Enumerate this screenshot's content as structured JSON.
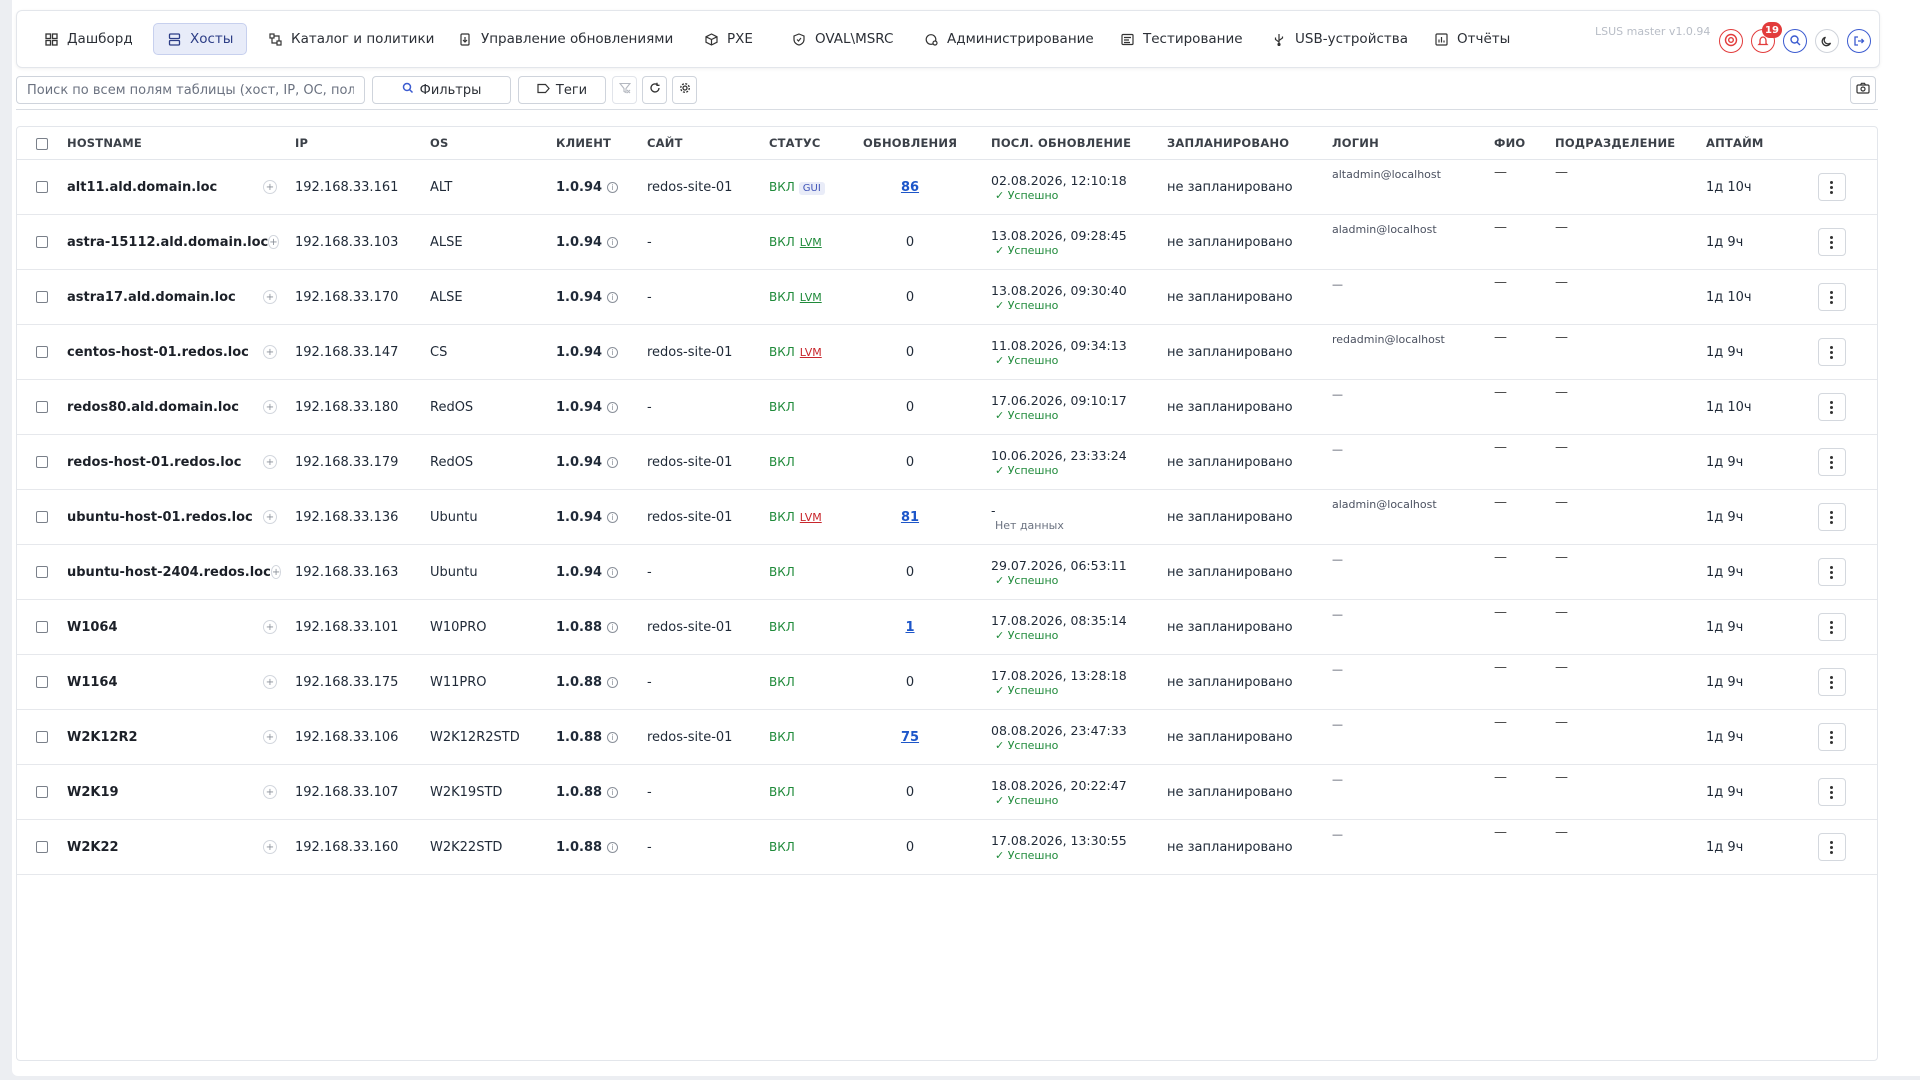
{
  "nav": {
    "tabs": [
      {
        "label": "Дашборд",
        "icon": "dashboard-icon"
      },
      {
        "label": "Хосты",
        "icon": "hosts-icon",
        "active": true
      },
      {
        "label": "Каталог и политики",
        "icon": "catalog-icon"
      },
      {
        "label": "Управление обновлениями",
        "icon": "updates-icon"
      },
      {
        "label": "PXE",
        "icon": "pxe-icon"
      },
      {
        "label": "OVAL\\MSRC",
        "icon": "shield-icon"
      },
      {
        "label": "Администрирование",
        "icon": "admin-icon"
      },
      {
        "label": "Тестирование",
        "icon": "testing-icon"
      },
      {
        "label": "USB-устройства",
        "icon": "usb-icon"
      },
      {
        "label": "Отчёты",
        "icon": "reports-icon"
      }
    ],
    "version": "LSUS master v1.0.94",
    "notification_count": "19"
  },
  "toolbar": {
    "search_placeholder": "Поиск по всем полям таблицы (хост, IP, ОС, политика,",
    "filters_label": "Фильтры",
    "tags_label": "Теги"
  },
  "colors": {
    "accent": "#2c3d86",
    "success": "#1f8a3a",
    "danger": "#c8262c",
    "link": "#1d56c9"
  },
  "table": {
    "columns": [
      "HOSTNAME",
      "IP",
      "OS",
      "КЛИЕНТ",
      "САЙТ",
      "СТАТУС",
      "ОБНОВЛЕНИЯ",
      "ПОСЛ. ОБНОВЛЕНИЕ",
      "ЗАПЛАНИРОВАНО",
      "ЛОГИН",
      "ФИО",
      "ПОДРАЗДЕЛЕНИЕ",
      "АПТАЙМ"
    ],
    "rows": [
      {
        "hostname": "alt11.ald.domain.loc",
        "ip": "192.168.33.161",
        "os": "ALT",
        "client": "1.0.94",
        "site": "redos-site-01",
        "status": "ВКЛ",
        "tag": "GUI",
        "tag_type": "gui",
        "updates": "86",
        "updates_link": true,
        "last_update": "02.08.2026, 12:10:18",
        "last_result": "✓ Успешно",
        "scheduled": "не запланировано",
        "login": "altadmin@localhost",
        "fio": "—",
        "dept": "—",
        "uptime": "1д 10ч"
      },
      {
        "hostname": "astra-15112.ald.domain.loc",
        "ip": "192.168.33.103",
        "os": "ALSE",
        "client": "1.0.94",
        "site": "-",
        "status": "ВКЛ",
        "tag": "LVM",
        "tag_type": "lvm-g",
        "updates": "0",
        "updates_link": false,
        "last_update": "13.08.2026, 09:28:45",
        "last_result": "✓ Успешно",
        "scheduled": "не запланировано",
        "login": "aladmin@localhost",
        "fio": "—",
        "dept": "—",
        "uptime": "1д 9ч"
      },
      {
        "hostname": "astra17.ald.domain.loc",
        "ip": "192.168.33.170",
        "os": "ALSE",
        "client": "1.0.94",
        "site": "-",
        "status": "ВКЛ",
        "tag": "LVM",
        "tag_type": "lvm-g",
        "updates": "0",
        "updates_link": false,
        "last_update": "13.08.2026, 09:30:40",
        "last_result": "✓ Успешно",
        "scheduled": "не запланировано",
        "login": "—",
        "fio": "—",
        "dept": "—",
        "uptime": "1д 10ч"
      },
      {
        "hostname": "centos-host-01.redos.loc",
        "ip": "192.168.33.147",
        "os": "CS",
        "client": "1.0.94",
        "site": "redos-site-01",
        "status": "ВКЛ",
        "tag": "LVM",
        "tag_type": "lvm-r",
        "updates": "0",
        "updates_link": false,
        "last_update": "11.08.2026, 09:34:13",
        "last_result": "✓ Успешно",
        "scheduled": "не запланировано",
        "login": "redadmin@localhost",
        "fio": "—",
        "dept": "—",
        "uptime": "1д 9ч"
      },
      {
        "hostname": "redos80.ald.domain.loc",
        "ip": "192.168.33.180",
        "os": "RedOS",
        "client": "1.0.94",
        "site": "-",
        "status": "ВКЛ",
        "tag": "",
        "tag_type": "",
        "updates": "0",
        "updates_link": false,
        "last_update": "17.06.2026, 09:10:17",
        "last_result": "✓ Успешно",
        "scheduled": "не запланировано",
        "login": "—",
        "fio": "—",
        "dept": "—",
        "uptime": "1д 10ч"
      },
      {
        "hostname": "redos-host-01.redos.loc",
        "ip": "192.168.33.179",
        "os": "RedOS",
        "client": "1.0.94",
        "site": "redos-site-01",
        "status": "ВКЛ",
        "tag": "",
        "tag_type": "",
        "updates": "0",
        "updates_link": false,
        "last_update": "10.06.2026, 23:33:24",
        "last_result": "✓ Успешно",
        "scheduled": "не запланировано",
        "login": "—",
        "fio": "—",
        "dept": "—",
        "uptime": "1д 9ч"
      },
      {
        "hostname": "ubuntu-host-01.redos.loc",
        "ip": "192.168.33.136",
        "os": "Ubuntu",
        "client": "1.0.94",
        "site": "redos-site-01",
        "status": "ВКЛ",
        "tag": "LVM",
        "tag_type": "lvm-r",
        "updates": "81",
        "updates_link": true,
        "last_update": "-",
        "last_result": "Нет данных",
        "scheduled": "не запланировано",
        "login": "aladmin@localhost",
        "fio": "—",
        "dept": "—",
        "uptime": "1д 9ч"
      },
      {
        "hostname": "ubuntu-host-2404.redos.loc",
        "ip": "192.168.33.163",
        "os": "Ubuntu",
        "client": "1.0.94",
        "site": "-",
        "status": "ВКЛ",
        "tag": "",
        "tag_type": "",
        "updates": "0",
        "updates_link": false,
        "last_update": "29.07.2026, 06:53:11",
        "last_result": "✓ Успешно",
        "scheduled": "не запланировано",
        "login": "—",
        "fio": "—",
        "dept": "—",
        "uptime": "1д 9ч"
      },
      {
        "hostname": "W1064",
        "ip": "192.168.33.101",
        "os": "W10PRO",
        "client": "1.0.88",
        "site": "redos-site-01",
        "status": "ВКЛ",
        "tag": "",
        "tag_type": "",
        "updates": "1",
        "updates_link": true,
        "last_update": "17.08.2026, 08:35:14",
        "last_result": "✓ Успешно",
        "scheduled": "не запланировано",
        "login": "—",
        "fio": "—",
        "dept": "—",
        "uptime": "1д 9ч"
      },
      {
        "hostname": "W1164",
        "ip": "192.168.33.175",
        "os": "W11PRO",
        "client": "1.0.88",
        "site": "-",
        "status": "ВКЛ",
        "tag": "",
        "tag_type": "",
        "updates": "0",
        "updates_link": false,
        "last_update": "17.08.2026, 13:28:18",
        "last_result": "✓ Успешно",
        "scheduled": "не запланировано",
        "login": "—",
        "fio": "—",
        "dept": "—",
        "uptime": "1д 9ч"
      },
      {
        "hostname": "W2K12R2",
        "ip": "192.168.33.106",
        "os": "W2K12R2STD",
        "client": "1.0.88",
        "site": "redos-site-01",
        "status": "ВКЛ",
        "tag": "",
        "tag_type": "",
        "updates": "75",
        "updates_link": true,
        "last_update": "08.08.2026, 23:47:33",
        "last_result": "✓ Успешно",
        "scheduled": "не запланировано",
        "login": "—",
        "fio": "—",
        "dept": "—",
        "uptime": "1д 9ч"
      },
      {
        "hostname": "W2K19",
        "ip": "192.168.33.107",
        "os": "W2K19STD",
        "client": "1.0.88",
        "site": "-",
        "status": "ВКЛ",
        "tag": "",
        "tag_type": "",
        "updates": "0",
        "updates_link": false,
        "last_update": "18.08.2026, 20:22:47",
        "last_result": "✓ Успешно",
        "scheduled": "не запланировано",
        "login": "—",
        "fio": "—",
        "dept": "—",
        "uptime": "1д 9ч"
      },
      {
        "hostname": "W2K22",
        "ip": "192.168.33.160",
        "os": "W2K22STD",
        "client": "1.0.88",
        "site": "-",
        "status": "ВКЛ",
        "tag": "",
        "tag_type": "",
        "updates": "0",
        "updates_link": false,
        "last_update": "17.08.2026, 13:30:55",
        "last_result": "✓ Успешно",
        "scheduled": "не запланировано",
        "login": "—",
        "fio": "—",
        "dept": "—",
        "uptime": "1д 9ч"
      }
    ]
  }
}
